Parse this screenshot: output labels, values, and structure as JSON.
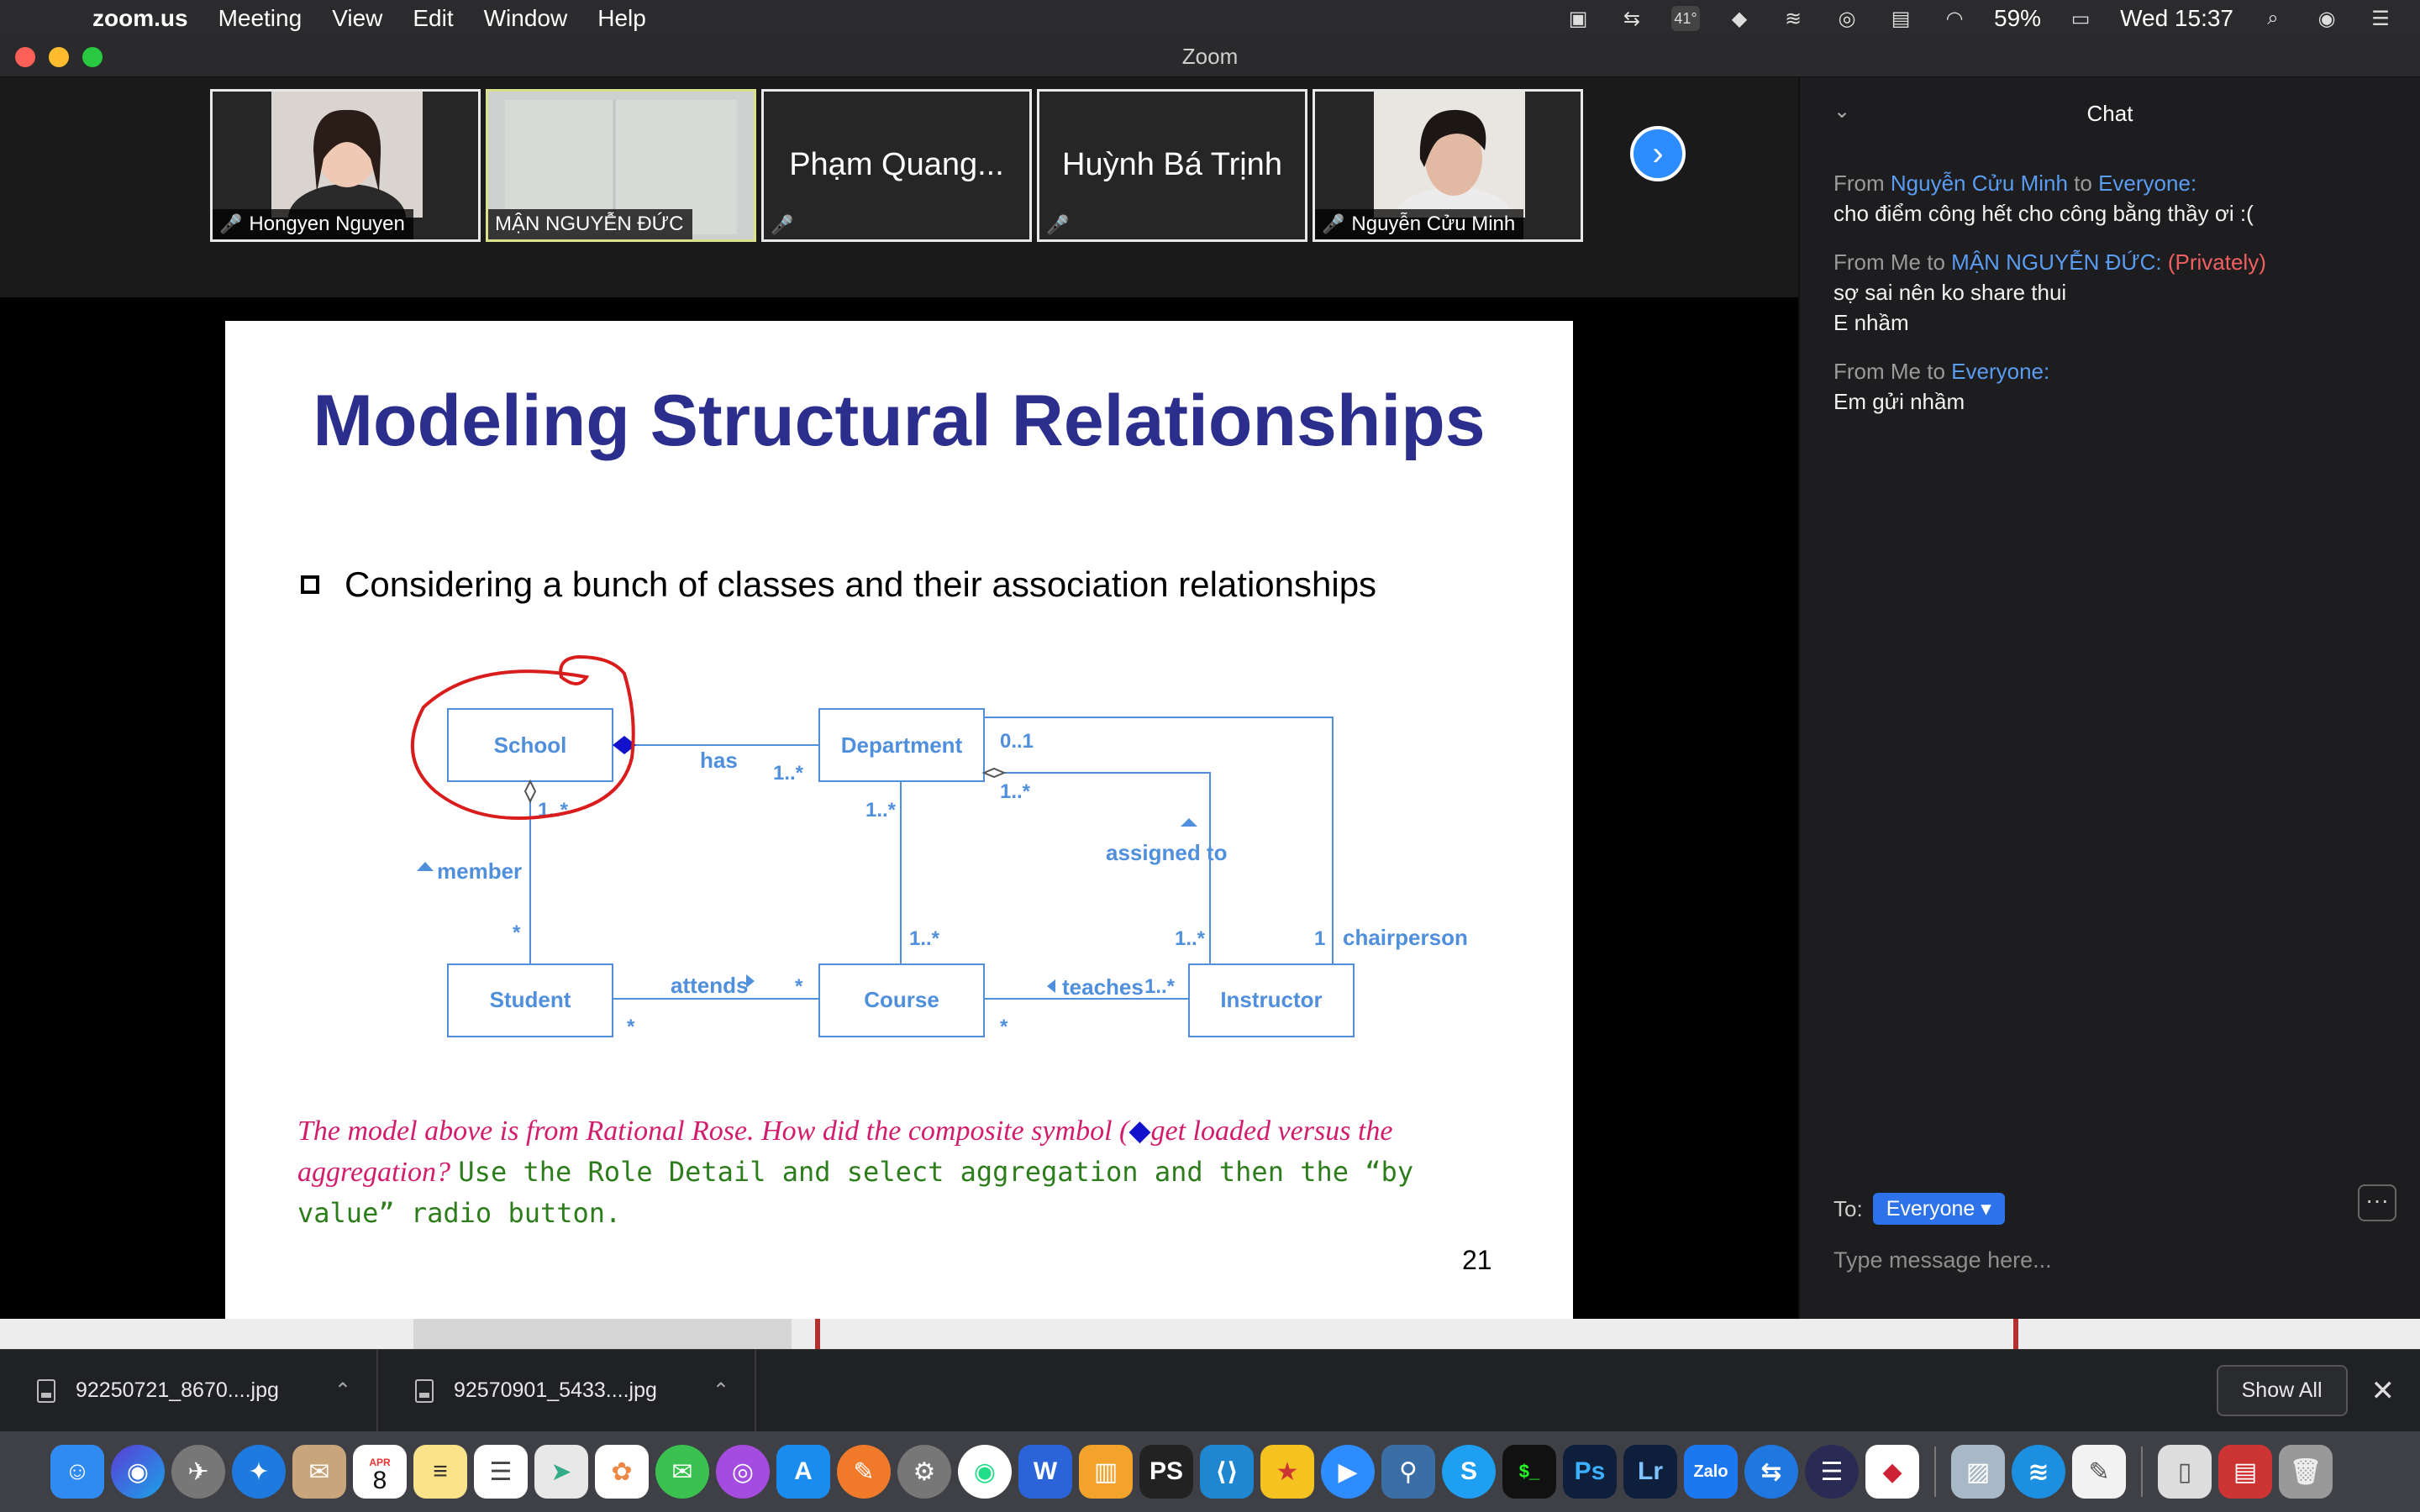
{
  "menubar": {
    "app_name": "zoom.us",
    "menus": [
      "Meeting",
      "View",
      "Edit",
      "Window",
      "Help"
    ],
    "temperature": "41°",
    "battery": "59%",
    "clock": "Wed 15:37"
  },
  "window": {
    "title": "Zoom"
  },
  "participants": [
    {
      "name": "Hongyen Nguyen",
      "type": "video",
      "muted": true
    },
    {
      "name": "MẬN NGUYỄN ĐỨC",
      "type": "video",
      "muted": false,
      "active": true
    },
    {
      "name": "Phạm Quang...",
      "type": "name",
      "muted": true
    },
    {
      "name": "Huỳnh Bá Trịnh",
      "type": "name",
      "muted": true
    },
    {
      "name": "Nguyễn Cửu Minh",
      "type": "video",
      "muted": true
    }
  ],
  "slide": {
    "title": "Modeling Structural Relationships",
    "bullet": "Considering a bunch of classes and their association relationships",
    "diagram": {
      "classes": [
        "School",
        "Department",
        "Student",
        "Course",
        "Instructor"
      ],
      "labels": {
        "has": "has",
        "has_mult": "1..*",
        "dept_mult": "0..1",
        "dept_mult2": "1..*",
        "school_mult": "1..*",
        "member": "member",
        "member_mult": "*",
        "dept_course": "1..*",
        "course_top": "1..*",
        "assigned_to": "assigned to",
        "instr_mult": "1..*",
        "chair_mult": "1",
        "chairperson": "chairperson",
        "attends": "attends",
        "attends_mult": "*",
        "student_mult": "*",
        "teaches": "teaches",
        "teaches_mult": "1..*",
        "course_mult": "*"
      }
    },
    "note_pink_1": "The model above is from Rational Rose. How did the composite symbol (",
    "note_pink_2": "get loaded versus the aggregation?",
    "note_green": "Use the Role Detail and select aggregation and then the “by value” radio button.",
    "page_number": "21"
  },
  "chat": {
    "title": "Chat",
    "messages": [
      {
        "from": "Nguyễn Cửu Minh",
        "to": "Everyone",
        "private": "",
        "lines": [
          "cho điểm công hết cho công bằng thầy ơi :("
        ]
      },
      {
        "from": "Me",
        "to": "MẬN NGUYỄN ĐỨC:",
        "private": "(Privately)",
        "lines": [
          "sợ sai nên ko share thui",
          "E nhầm"
        ]
      },
      {
        "from": "Me",
        "to": "Everyone:",
        "private": "",
        "lines": [
          "Em gửi nhầm"
        ]
      }
    ],
    "to_label": "To:",
    "recipient": "Everyone",
    "placeholder": "Type message here..."
  },
  "downloads": {
    "items": [
      "92250721_8670....jpg",
      "92570901_5433....jpg"
    ],
    "show_all": "Show All"
  },
  "dock": {
    "calendar_month": "APR",
    "calendar_day": "8",
    "ps_label": "Ps",
    "lr_label": "Lr",
    "zalo_label": "Zalo"
  },
  "colors": {
    "slide_title": "#2b2e8c",
    "uml_blue": "#4f8fdc",
    "annotation_red": "#d91c1c",
    "chat_link": "#5a9cf2",
    "zoom_blue": "#2d8cff"
  }
}
